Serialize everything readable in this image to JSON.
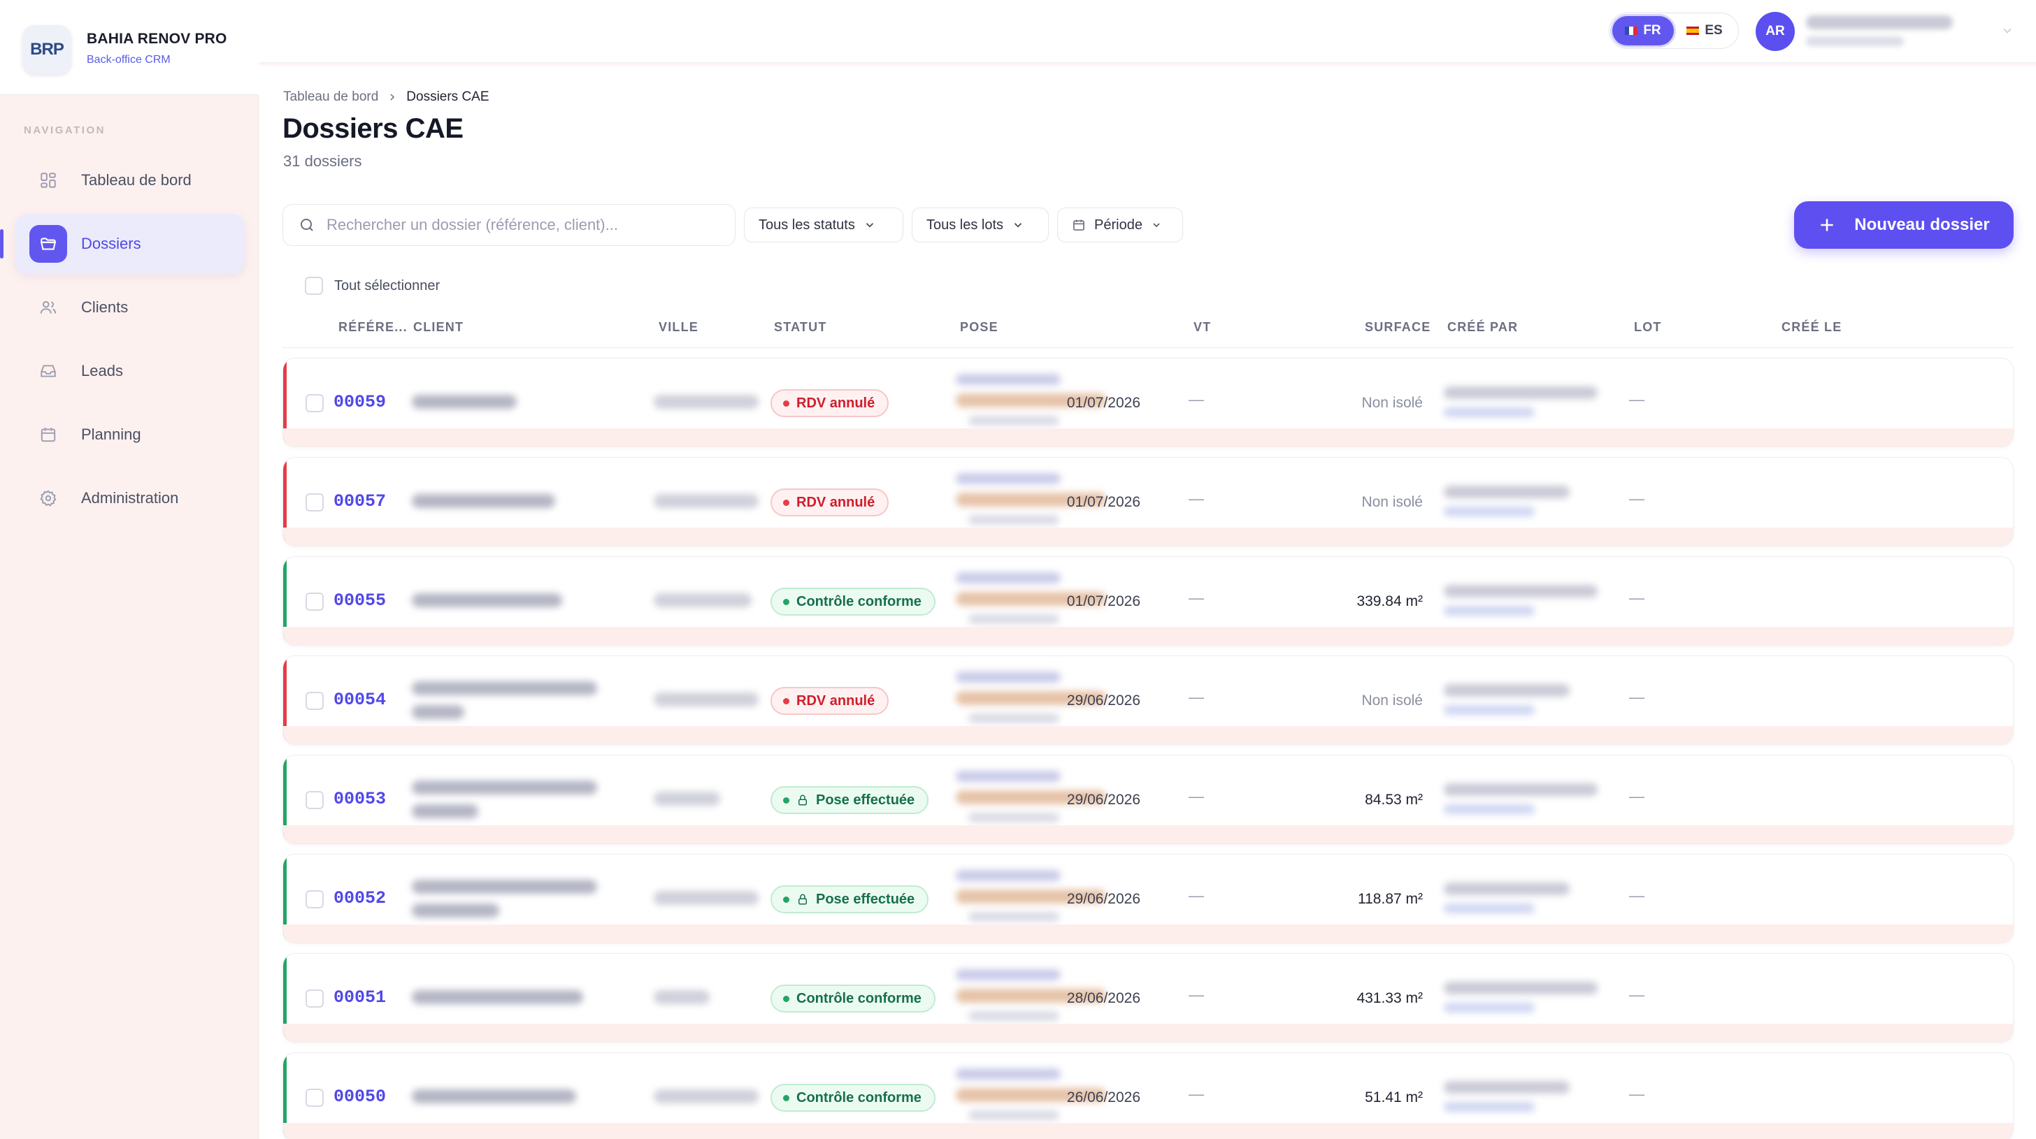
{
  "app": {
    "logo_text": "BRP",
    "name": "BAHIA RENOV PRO",
    "subtitle": "Back-office CRM"
  },
  "sidebar": {
    "heading": "NAVIGATION",
    "items": [
      {
        "label": "Tableau de bord",
        "icon": "dashboard-icon",
        "active": false
      },
      {
        "label": "Dossiers",
        "icon": "folder-icon",
        "active": true
      },
      {
        "label": "Clients",
        "icon": "users-icon",
        "active": false
      },
      {
        "label": "Leads",
        "icon": "inbox-icon",
        "active": false
      },
      {
        "label": "Planning",
        "icon": "calendar-icon",
        "active": false
      },
      {
        "label": "Administration",
        "icon": "gear-icon",
        "active": false
      }
    ]
  },
  "topbar": {
    "languages": [
      {
        "code": "FR",
        "active": true
      },
      {
        "code": "ES",
        "active": false
      }
    ],
    "avatar_initials": "AR"
  },
  "breadcrumb": {
    "root": "Tableau de bord",
    "current": "Dossiers CAE"
  },
  "page": {
    "title": "Dossiers CAE",
    "count": "31 dossiers"
  },
  "toolbar": {
    "search_placeholder": "Rechercher un dossier (référence, client)...",
    "filter_status": "Tous les statuts",
    "filter_lots": "Tous les lots",
    "filter_period": "Période",
    "new_button": "Nouveau dossier",
    "select_all": "Tout sélectionner"
  },
  "table": {
    "columns": {
      "reference": "RÉFÉRE...",
      "client": "CLIENT",
      "ville": "VILLE",
      "statut": "STATUT",
      "pose": "POSE",
      "vt": "VT",
      "surface": "SURFACE",
      "cree_par": "CRÉÉ PAR",
      "lot": "LOT",
      "cree_le": "CRÉÉ LE"
    },
    "rows": [
      {
        "ref": "00059",
        "status": "RDV annulé",
        "tone": "red",
        "lock": false,
        "vt": "—",
        "surface": "Non isolé",
        "lot": "—",
        "date": "01/07/2026"
      },
      {
        "ref": "00057",
        "status": "RDV annulé",
        "tone": "red",
        "lock": false,
        "vt": "—",
        "surface": "Non isolé",
        "lot": "—",
        "date": "01/07/2026"
      },
      {
        "ref": "00055",
        "status": "Contrôle conforme",
        "tone": "green",
        "lock": false,
        "vt": "—",
        "surface": "339.84 m²",
        "lot": "—",
        "date": "01/07/2026"
      },
      {
        "ref": "00054",
        "status": "RDV annulé",
        "tone": "red",
        "lock": false,
        "vt": "—",
        "surface": "Non isolé",
        "lot": "—",
        "date": "29/06/2026"
      },
      {
        "ref": "00053",
        "status": "Pose effectuée",
        "tone": "green",
        "lock": true,
        "vt": "—",
        "surface": "84.53 m²",
        "lot": "—",
        "date": "29/06/2026"
      },
      {
        "ref": "00052",
        "status": "Pose effectuée",
        "tone": "green",
        "lock": true,
        "vt": "—",
        "surface": "118.87 m²",
        "lot": "—",
        "date": "29/06/2026"
      },
      {
        "ref": "00051",
        "status": "Contrôle conforme",
        "tone": "green",
        "lock": false,
        "vt": "—",
        "surface": "431.33 m²",
        "lot": "—",
        "date": "28/06/2026"
      },
      {
        "ref": "00050",
        "status": "Contrôle conforme",
        "tone": "green",
        "lock": false,
        "vt": "—",
        "surface": "51.41 m²",
        "lot": "—",
        "date": "26/06/2026"
      }
    ]
  },
  "colors": {
    "accent": "#5d4ff0",
    "danger": "#e33d48",
    "success": "#22a565"
  }
}
